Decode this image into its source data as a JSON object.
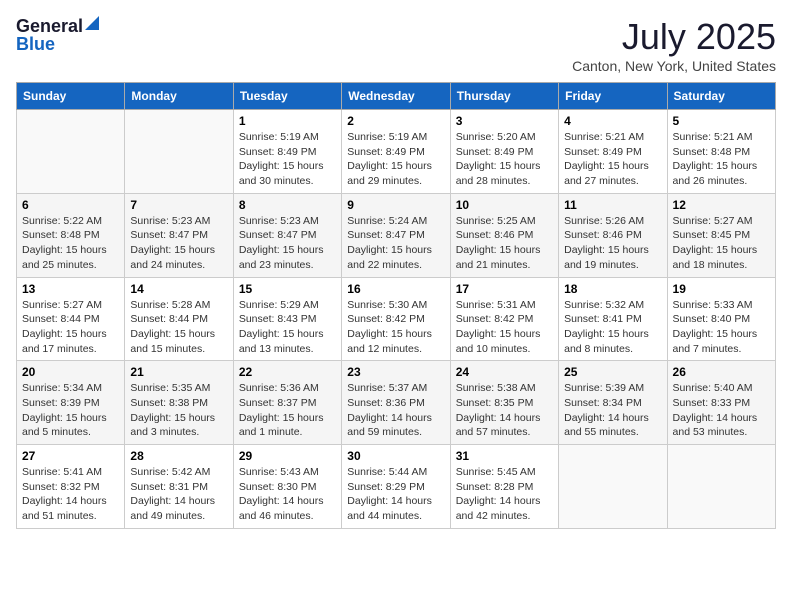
{
  "logo": {
    "general": "General",
    "blue": "Blue"
  },
  "title": "July 2025",
  "subtitle": "Canton, New York, United States",
  "days_of_week": [
    "Sunday",
    "Monday",
    "Tuesday",
    "Wednesday",
    "Thursday",
    "Friday",
    "Saturday"
  ],
  "weeks": [
    [
      {
        "day": "",
        "info": ""
      },
      {
        "day": "",
        "info": ""
      },
      {
        "day": "1",
        "info": "Sunrise: 5:19 AM\nSunset: 8:49 PM\nDaylight: 15 hours and 30 minutes."
      },
      {
        "day": "2",
        "info": "Sunrise: 5:19 AM\nSunset: 8:49 PM\nDaylight: 15 hours and 29 minutes."
      },
      {
        "day": "3",
        "info": "Sunrise: 5:20 AM\nSunset: 8:49 PM\nDaylight: 15 hours and 28 minutes."
      },
      {
        "day": "4",
        "info": "Sunrise: 5:21 AM\nSunset: 8:49 PM\nDaylight: 15 hours and 27 minutes."
      },
      {
        "day": "5",
        "info": "Sunrise: 5:21 AM\nSunset: 8:48 PM\nDaylight: 15 hours and 26 minutes."
      }
    ],
    [
      {
        "day": "6",
        "info": "Sunrise: 5:22 AM\nSunset: 8:48 PM\nDaylight: 15 hours and 25 minutes."
      },
      {
        "day": "7",
        "info": "Sunrise: 5:23 AM\nSunset: 8:47 PM\nDaylight: 15 hours and 24 minutes."
      },
      {
        "day": "8",
        "info": "Sunrise: 5:23 AM\nSunset: 8:47 PM\nDaylight: 15 hours and 23 minutes."
      },
      {
        "day": "9",
        "info": "Sunrise: 5:24 AM\nSunset: 8:47 PM\nDaylight: 15 hours and 22 minutes."
      },
      {
        "day": "10",
        "info": "Sunrise: 5:25 AM\nSunset: 8:46 PM\nDaylight: 15 hours and 21 minutes."
      },
      {
        "day": "11",
        "info": "Sunrise: 5:26 AM\nSunset: 8:46 PM\nDaylight: 15 hours and 19 minutes."
      },
      {
        "day": "12",
        "info": "Sunrise: 5:27 AM\nSunset: 8:45 PM\nDaylight: 15 hours and 18 minutes."
      }
    ],
    [
      {
        "day": "13",
        "info": "Sunrise: 5:27 AM\nSunset: 8:44 PM\nDaylight: 15 hours and 17 minutes."
      },
      {
        "day": "14",
        "info": "Sunrise: 5:28 AM\nSunset: 8:44 PM\nDaylight: 15 hours and 15 minutes."
      },
      {
        "day": "15",
        "info": "Sunrise: 5:29 AM\nSunset: 8:43 PM\nDaylight: 15 hours and 13 minutes."
      },
      {
        "day": "16",
        "info": "Sunrise: 5:30 AM\nSunset: 8:42 PM\nDaylight: 15 hours and 12 minutes."
      },
      {
        "day": "17",
        "info": "Sunrise: 5:31 AM\nSunset: 8:42 PM\nDaylight: 15 hours and 10 minutes."
      },
      {
        "day": "18",
        "info": "Sunrise: 5:32 AM\nSunset: 8:41 PM\nDaylight: 15 hours and 8 minutes."
      },
      {
        "day": "19",
        "info": "Sunrise: 5:33 AM\nSunset: 8:40 PM\nDaylight: 15 hours and 7 minutes."
      }
    ],
    [
      {
        "day": "20",
        "info": "Sunrise: 5:34 AM\nSunset: 8:39 PM\nDaylight: 15 hours and 5 minutes."
      },
      {
        "day": "21",
        "info": "Sunrise: 5:35 AM\nSunset: 8:38 PM\nDaylight: 15 hours and 3 minutes."
      },
      {
        "day": "22",
        "info": "Sunrise: 5:36 AM\nSunset: 8:37 PM\nDaylight: 15 hours and 1 minute."
      },
      {
        "day": "23",
        "info": "Sunrise: 5:37 AM\nSunset: 8:36 PM\nDaylight: 14 hours and 59 minutes."
      },
      {
        "day": "24",
        "info": "Sunrise: 5:38 AM\nSunset: 8:35 PM\nDaylight: 14 hours and 57 minutes."
      },
      {
        "day": "25",
        "info": "Sunrise: 5:39 AM\nSunset: 8:34 PM\nDaylight: 14 hours and 55 minutes."
      },
      {
        "day": "26",
        "info": "Sunrise: 5:40 AM\nSunset: 8:33 PM\nDaylight: 14 hours and 53 minutes."
      }
    ],
    [
      {
        "day": "27",
        "info": "Sunrise: 5:41 AM\nSunset: 8:32 PM\nDaylight: 14 hours and 51 minutes."
      },
      {
        "day": "28",
        "info": "Sunrise: 5:42 AM\nSunset: 8:31 PM\nDaylight: 14 hours and 49 minutes."
      },
      {
        "day": "29",
        "info": "Sunrise: 5:43 AM\nSunset: 8:30 PM\nDaylight: 14 hours and 46 minutes."
      },
      {
        "day": "30",
        "info": "Sunrise: 5:44 AM\nSunset: 8:29 PM\nDaylight: 14 hours and 44 minutes."
      },
      {
        "day": "31",
        "info": "Sunrise: 5:45 AM\nSunset: 8:28 PM\nDaylight: 14 hours and 42 minutes."
      },
      {
        "day": "",
        "info": ""
      },
      {
        "day": "",
        "info": ""
      }
    ]
  ]
}
